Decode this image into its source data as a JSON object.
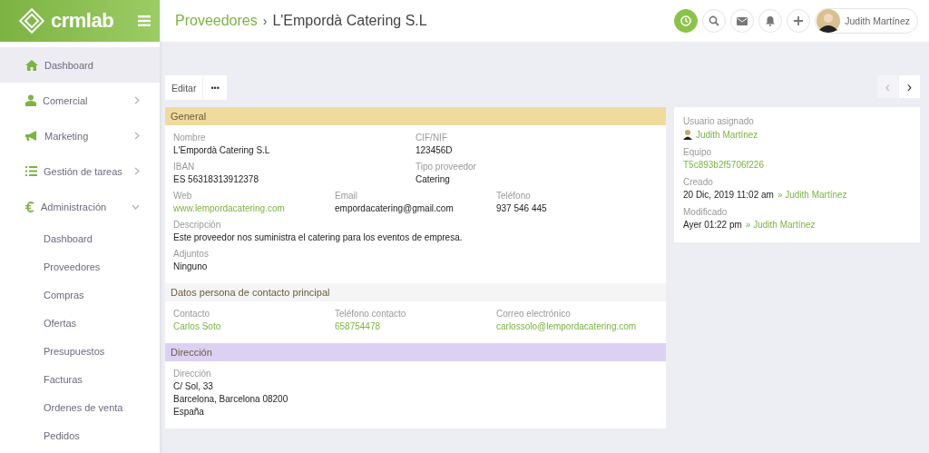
{
  "logo": {
    "text": "crmlab"
  },
  "breadcrumb": {
    "parent": "Proveedores",
    "separator": "›",
    "current": "L'Empordà Catering S.L"
  },
  "top_actions": [
    {
      "kind": "clock",
      "selected": true
    },
    {
      "kind": "search",
      "selected": false
    },
    {
      "kind": "mail",
      "selected": false
    },
    {
      "kind": "bell",
      "selected": false
    },
    {
      "kind": "plus",
      "selected": false
    }
  ],
  "user": {
    "name": "Judith Martínez"
  },
  "sidebar": {
    "items": [
      {
        "kind": "home",
        "label": "Dashboard",
        "selected": true
      },
      {
        "kind": "person",
        "label": "Comercial",
        "selected": false,
        "expanded": false
      },
      {
        "kind": "megaphone",
        "label": "Marketing",
        "selected": false,
        "expanded": false
      },
      {
        "kind": "tasks",
        "label": "Gestión de tareas",
        "selected": false,
        "expanded": false
      },
      {
        "kind": "euro",
        "label": "Administración",
        "selected": false,
        "expanded": true,
        "children": [
          {
            "label": "Dashboard",
            "selected": false
          },
          {
            "label": "Proveedores",
            "selected": false
          },
          {
            "label": "Compras",
            "selected": false
          },
          {
            "label": "Ofertas",
            "selected": false
          },
          {
            "label": "Presupuestos",
            "selected": false
          },
          {
            "label": "Facturas",
            "selected": false
          },
          {
            "label": "Ordenes de venta",
            "selected": false
          },
          {
            "label": "Pedidos",
            "selected": false
          }
        ]
      }
    ]
  },
  "toolbar": {
    "edit": "Editar",
    "more": "•••"
  },
  "pager": {
    "prev": "‹",
    "next": "›",
    "prev_disabled": true
  },
  "sections": [
    {
      "title": "General",
      "color": "#efdb9c",
      "rows": [
        [
          {
            "label": "Nombre",
            "value": [
              "L'Empordà Catering S.L"
            ],
            "link": false
          },
          {
            "label": "CIF/NIF",
            "value": [
              "123456D"
            ],
            "link": false
          }
        ],
        [
          {
            "label": "IBAN",
            "value": [
              "ES 56318313912378"
            ],
            "link": false
          },
          {
            "label": "Tipo proveedor",
            "value": [
              "Catering"
            ],
            "link": false
          }
        ],
        [
          {
            "label": "Web",
            "value": [
              "www.lempordacatering.com"
            ],
            "link": true
          },
          {
            "label": "Email",
            "value": [
              "empordacatering@gmail.com"
            ],
            "link": false
          },
          {
            "label": "Teléfono",
            "value": [
              "937 546 445"
            ],
            "link": false
          }
        ],
        [
          {
            "label": "Descripción",
            "value": [
              "Este proveedor nos suministra el catering para los eventos de empresa."
            ],
            "link": false
          }
        ],
        [
          {
            "label": "Adjuntos",
            "value": [
              "Ninguno"
            ],
            "link": false
          }
        ]
      ]
    },
    {
      "title": "Datos persona de contacto principal",
      "color": "#f5f5f5",
      "rows": [
        [
          {
            "label": "Contacto",
            "value": [
              "Carlos Soto"
            ],
            "link": true
          },
          {
            "label": "Teléfono contacto",
            "value": [
              "658754478"
            ],
            "link": true
          },
          {
            "label": "Correo electrónico",
            "value": [
              "carlossolo@lempordacatering.com"
            ],
            "link": true
          }
        ]
      ]
    },
    {
      "title": "Dirección",
      "color": "#dcd1f3",
      "rows": [
        [
          {
            "label": "Dirección",
            "value": [
              "C/ Sol, 33",
              "Barcelona, Barcelona 08200",
              "España"
            ],
            "link": false
          }
        ]
      ]
    }
  ],
  "info": [
    {
      "label": "Usuario asignado",
      "avatar": true,
      "link": "Judith Martínez"
    },
    {
      "label": "Equipo",
      "link": "T5c893b2f5706f226"
    },
    {
      "label": "Creado",
      "value": "20 Dic, 2019 11:02 am",
      "link": "» Judith Martínez"
    },
    {
      "label": "Modificado",
      "value": "Ayer 01:22 pm",
      "link": "» Judith Martínez"
    }
  ]
}
